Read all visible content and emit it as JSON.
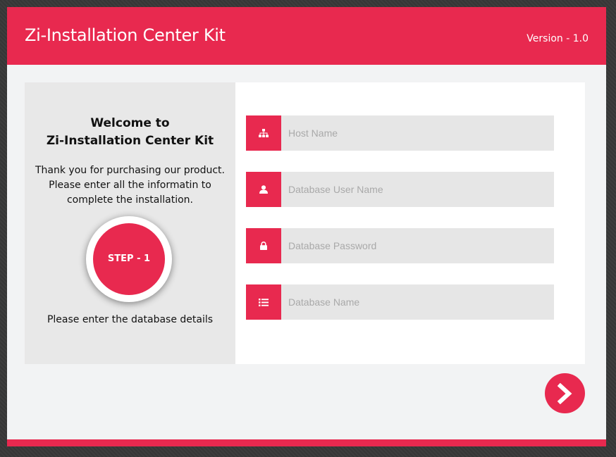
{
  "header": {
    "title": "Zi-Installation Center Kit",
    "version": "Version - 1.0"
  },
  "intro": {
    "welcome_line1": "Welcome to",
    "welcome_line2": "Zi-Installation Center Kit",
    "thanks_line1": "Thank you for purchasing our product.",
    "thanks_line2": "Please enter all the informatin to",
    "thanks_line3": "complete the installation.",
    "step_label": "STEP - 1",
    "step_note": "Please enter the database details"
  },
  "form": {
    "fields": [
      {
        "placeholder": "Host Name",
        "icon": "sitemap-icon"
      },
      {
        "placeholder": "Database User Name",
        "icon": "user-icon"
      },
      {
        "placeholder": "Database Password",
        "icon": "lock-icon"
      },
      {
        "placeholder": "Database Name",
        "icon": "list-icon"
      }
    ]
  },
  "actions": {
    "next_icon": "chevron-right-icon"
  },
  "colors": {
    "accent": "#e8294f",
    "panel_left": "#e8e8e8",
    "input_bg": "#e6e6e6",
    "window_bg": "#f2f3f4"
  }
}
